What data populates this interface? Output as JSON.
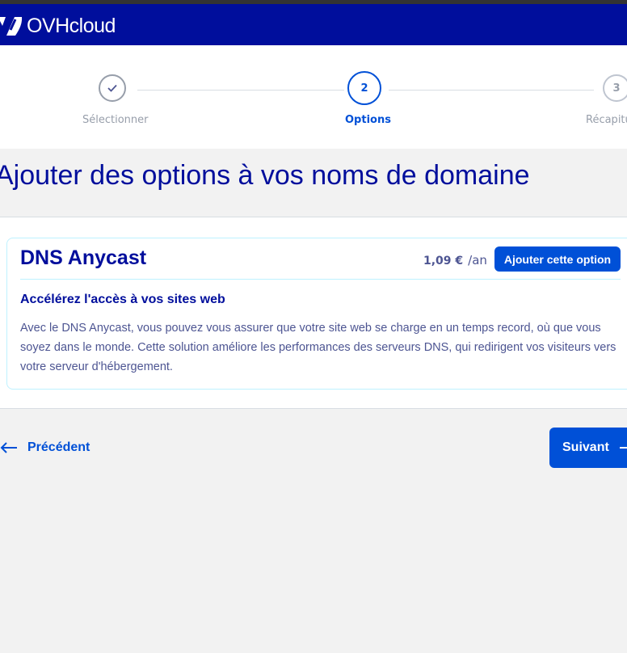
{
  "header": {
    "logo_text": "OVHcloud",
    "brand_color": "#000e9c",
    "logo_icon": "ovhcloud-logo-icon"
  },
  "stepper": {
    "steps": [
      {
        "label": "Sélectionner",
        "number": "",
        "state": "done",
        "icon": "check-icon"
      },
      {
        "label": "Options",
        "number": "2",
        "state": "active"
      },
      {
        "label": "Récapitu",
        "number": "3",
        "state": "todo"
      }
    ]
  },
  "page": {
    "title": "Ajouter des options à vos noms de domaine"
  },
  "option_card": {
    "title": "DNS Anycast",
    "price": "1,09 €",
    "period": "/an",
    "add_button": "Ajouter cette option",
    "subtitle": "Accélérez l'accès à vos sites web",
    "description": "Avec le DNS Anycast, vous pouvez vous assurer que votre site web se charge en un temps record, où que vous soyez dans le monde. Cette solution améliore les performances des serveurs DNS, qui redirigent vos visiteurs vers votre serveur d'hébergement."
  },
  "navigation": {
    "previous_label": "Précédent",
    "previous_icon": "arrow-left-icon",
    "next_label": "Suivant",
    "next_icon": "arrow-right-icon"
  },
  "colors": {
    "primary": "#0050d7",
    "muted_text": "#4d5592",
    "card_border": "#bef1ff"
  }
}
